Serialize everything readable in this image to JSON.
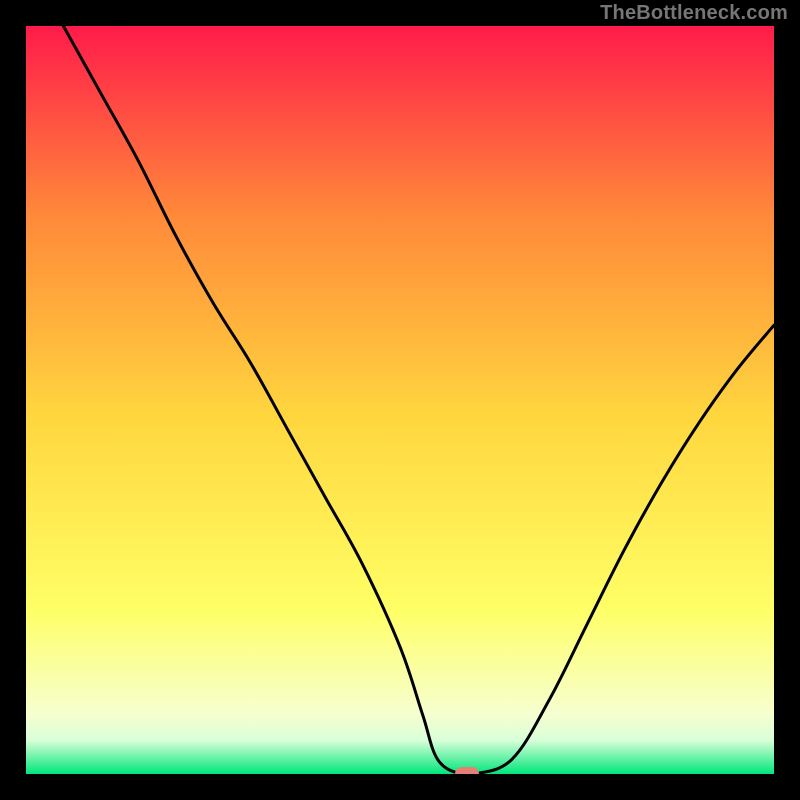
{
  "watermark": "TheBottleneck.com",
  "colors": {
    "top": "#ff1b4a",
    "upper_mid": "#ff883a",
    "mid": "#ffd63e",
    "lower_mid": "#ffff66",
    "near_bottom": "#f6ffd0",
    "bottom_band_top": "#d8ffd8",
    "bottom": "#00e67a",
    "curve": "#000000",
    "marker": "#e77f74",
    "frame": "#000000"
  },
  "chart_data": {
    "type": "line",
    "title": "",
    "xlabel": "",
    "ylabel": "",
    "xlim": [
      0,
      100
    ],
    "ylim": [
      0,
      100
    ],
    "series": [
      {
        "name": "bottleneck-curve",
        "x": [
          5,
          10,
          15,
          20,
          25,
          30,
          35,
          40,
          45,
          50,
          53,
          55,
          58,
          60,
          65,
          70,
          75,
          80,
          85,
          90,
          95,
          100
        ],
        "y": [
          100,
          91,
          82,
          72,
          63,
          55,
          46,
          37,
          28,
          17,
          8,
          2,
          0,
          0,
          2,
          10,
          20,
          30,
          39,
          47,
          54,
          60
        ]
      }
    ],
    "marker": {
      "x": 59,
      "y": 0
    },
    "notes": "y is percent distance above bottom (0 = green baseline, 100 = top). Values estimated from pixels; no axes shown in source image."
  }
}
